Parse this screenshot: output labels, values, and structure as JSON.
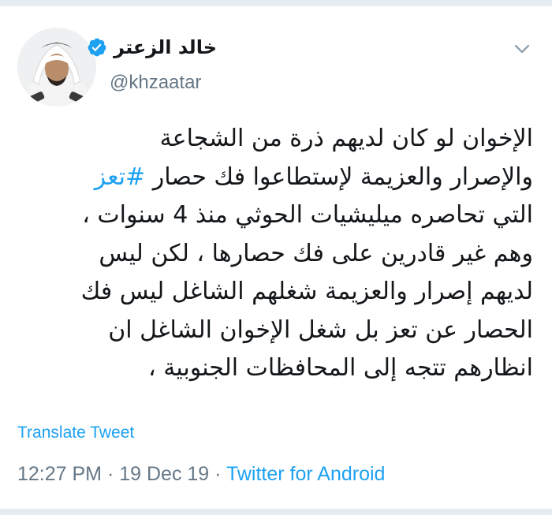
{
  "tweet": {
    "author": {
      "name": "خالد الزعتر",
      "handle": "@khzaatar",
      "verified": true
    },
    "body_lines": [
      {
        "text": "الإخوان لو كان لديهم ذرة من الشجاعة"
      },
      {
        "pre": "والإصرار والعزيمة لإستطاعوا فك حصار ",
        "hashtag": "#تعز"
      },
      {
        "text": "التي تحاصره ميليشيات الحوثي منذ 4 سنوات ،"
      },
      {
        "text": "وهم غير قادرين على فك حصارها ، لكن ليس"
      },
      {
        "text": "لديهم إصرار والعزيمة شغلهم الشاغل ليس فك"
      },
      {
        "text": "الحصار عن تعز بل شغل الإخوان الشاغل ان"
      },
      {
        "text": "انظارهم تتجه إلى المحافظات الجنوبية ،"
      }
    ],
    "translate_label": "Translate Tweet",
    "time": "12:27 PM",
    "separator": " · ",
    "date": "19 Dec 19",
    "source": "Twitter for Android"
  },
  "icons": {
    "verified": "verified-badge-icon",
    "menu": "chevron-down-icon"
  },
  "colors": {
    "accent": "#1da1f2",
    "text": "#14171a",
    "secondary": "#657786",
    "divider": "#e6ecf0"
  }
}
